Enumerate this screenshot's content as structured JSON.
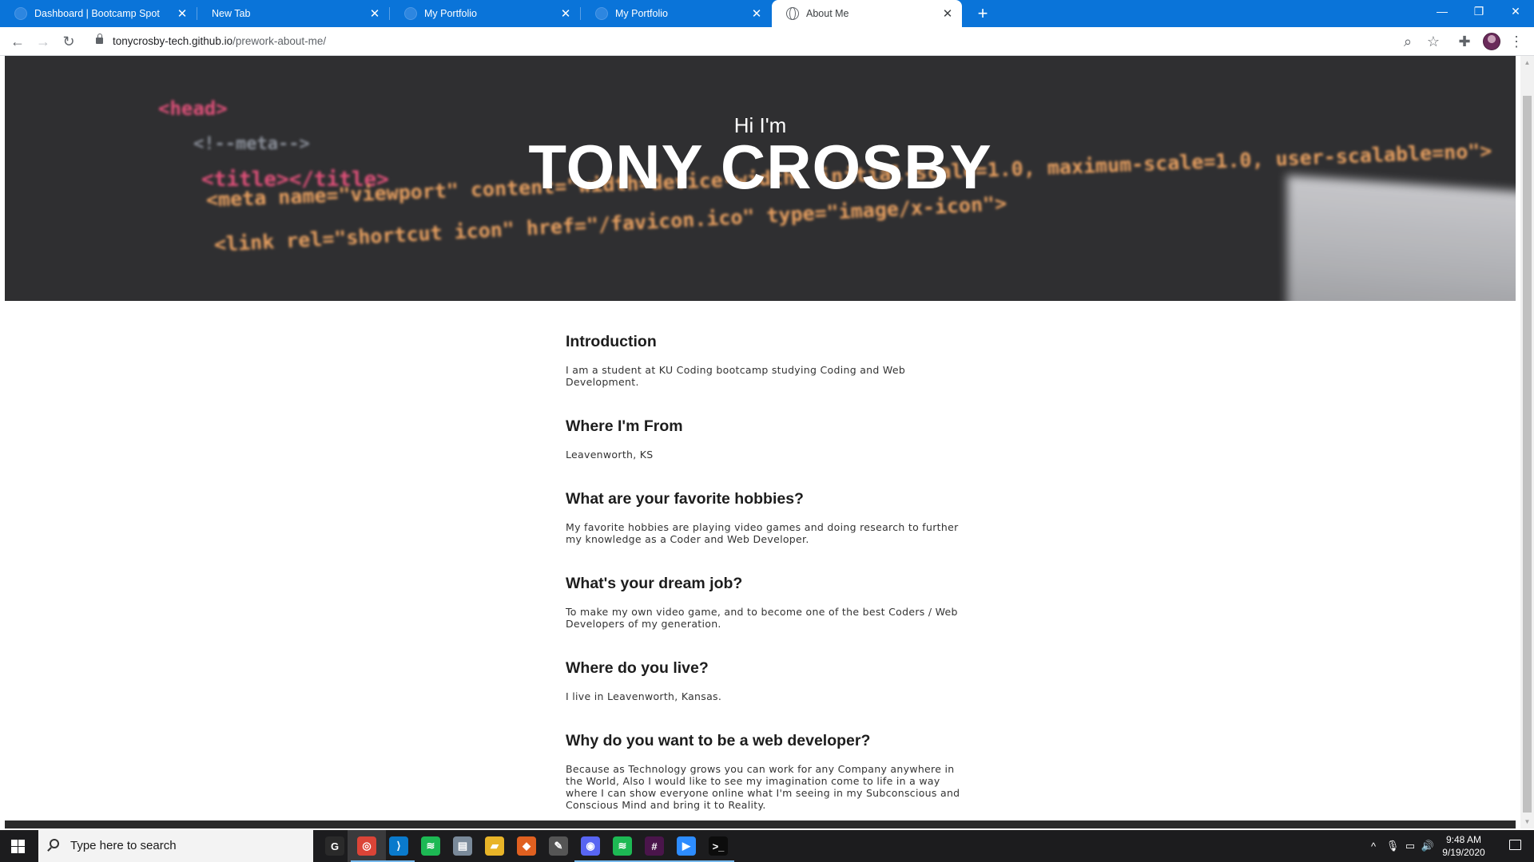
{
  "browser": {
    "tabs": [
      {
        "title": "Dashboard | Bootcamp Spot",
        "active": false
      },
      {
        "title": "New Tab",
        "active": false
      },
      {
        "title": "My Portfolio",
        "active": false
      },
      {
        "title": "My Portfolio",
        "active": false
      },
      {
        "title": "About Me",
        "active": true
      }
    ],
    "close_glyph": "✕",
    "new_tab_glyph": "+",
    "window_controls": {
      "minimize": "—",
      "restore": "❐",
      "close": "✕"
    },
    "url_host": "tonycrosby-tech.github.io",
    "url_path": "/prework-about-me/",
    "nav": {
      "back": "←",
      "forward": "→",
      "reload": "↻"
    },
    "toolbar_icons": {
      "zoom": "⌕",
      "bookmark": "☆",
      "extensions": "✚",
      "menu": "⋮"
    }
  },
  "hero": {
    "greeting": "Hi I'm",
    "name": "TONY CROSBY",
    "code_lines": [
      {
        "text": "<head>",
        "color": "#e0517a"
      },
      {
        "text": "<!--meta-->",
        "color": "#8a8f99"
      },
      {
        "text": "<title></title>",
        "color": "#e0517a"
      },
      {
        "text": "<meta name=\"viewport\" content=\"width=device-width, initial-scale=1.0, maximum-scale=1.0, user-scalable=no\">",
        "color": "#e8a060"
      },
      {
        "text": "<link rel=\"shortcut icon\" href=\"/favicon.ico\" type=\"image/x-icon\">",
        "color": "#e8a060"
      }
    ]
  },
  "sections": [
    {
      "heading": "Introduction",
      "body": "I am a student at KU Coding bootcamp studying Coding and Web Development."
    },
    {
      "heading": "Where I'm From",
      "body": "Leavenworth, KS"
    },
    {
      "heading": "What are your favorite hobbies?",
      "body": "My favorite hobbies are playing video games and doing research to further my knowledge as a Coder and Web Developer."
    },
    {
      "heading": "What's your dream job?",
      "body": "To make my own video game, and to become one of the best Coders / Web Developers of my generation."
    },
    {
      "heading": "Where do you live?",
      "body": "I live in Leavenworth, Kansas."
    },
    {
      "heading": "Why do you want to be a web developer?",
      "body": "Because as Technology grows you can work for any Company anywhere in the World, Also I would like to see my imagination come to life in a way where I can show everyone online what I'm seeing in my Subconscious and Conscious Mind and bring it to Reality."
    }
  ],
  "taskbar": {
    "search_placeholder": "Type here to search",
    "apps": [
      {
        "name": "g-hub-icon",
        "glyph": "G",
        "color": "#2a2a2a",
        "open": false,
        "active": false
      },
      {
        "name": "chrome-icon",
        "glyph": "◎",
        "color": "#db4437",
        "open": true,
        "active": true
      },
      {
        "name": "vscode-icon",
        "glyph": "⟩",
        "color": "#0a7acc",
        "open": true,
        "active": false
      },
      {
        "name": "spotify-icon",
        "glyph": "≋",
        "color": "#1db954",
        "open": false,
        "active": false
      },
      {
        "name": "notepad-icon",
        "glyph": "▤",
        "color": "#7a8a9a",
        "open": false,
        "active": false
      },
      {
        "name": "file-explorer-icon",
        "glyph": "▰",
        "color": "#e8b428",
        "open": false,
        "active": false
      },
      {
        "name": "firebrand-icon",
        "glyph": "◆",
        "color": "#e06020",
        "open": false,
        "active": false
      },
      {
        "name": "snip-icon",
        "glyph": "✎",
        "color": "#555555",
        "open": false,
        "active": false
      },
      {
        "name": "discord-icon",
        "glyph": "◉",
        "color": "#5865f2",
        "open": true,
        "active": false
      },
      {
        "name": "spotify-alt-icon",
        "glyph": "≋",
        "color": "#1db954",
        "open": true,
        "active": false
      },
      {
        "name": "slack-icon",
        "glyph": "#",
        "color": "#4a154b",
        "open": true,
        "active": false
      },
      {
        "name": "zoom-icon",
        "glyph": "▶",
        "color": "#2d8cff",
        "open": true,
        "active": false
      },
      {
        "name": "terminal-icon",
        "glyph": ">_",
        "color": "#0c0c0c",
        "open": true,
        "active": false
      }
    ],
    "tray": {
      "chevron": "^",
      "mic": "🎙",
      "network": "▭",
      "volume": "🔊"
    },
    "time": "9:48 AM",
    "date": "9/19/2020"
  },
  "colors": {
    "tabstrip": "#0a74d9",
    "hero_bg": "#2f2f31",
    "heading": "#1d1d1d",
    "body_text": "#333333",
    "taskbar": "#1c1c1e"
  }
}
